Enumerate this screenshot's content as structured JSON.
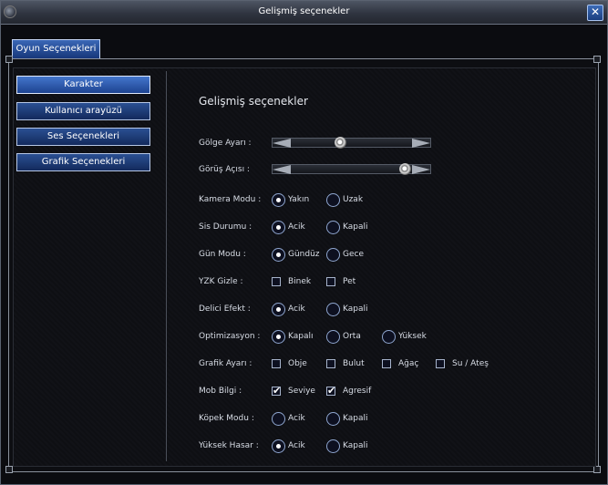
{
  "window": {
    "title": "Gelişmiş seçenekler",
    "close_glyph": "✕"
  },
  "tab": {
    "label": "Oyun Seçenekleri"
  },
  "menu": [
    {
      "label": "Karakter",
      "active": true
    },
    {
      "label": "Kullanıcı arayüzü",
      "active": false
    },
    {
      "label": "Ses Seçenekleri",
      "active": false
    },
    {
      "label": "Grafik Seçenekleri",
      "active": false
    }
  ],
  "content": {
    "title": "Gelişmiş seçenekler",
    "sliders": [
      {
        "label": "Gölge Ayarı :",
        "value": 0.43
      },
      {
        "label": "Görüş Açısı :",
        "value": 0.84
      }
    ],
    "rows": [
      {
        "label": "Kamera Modu :",
        "type": "radio",
        "options": [
          {
            "label": "Yakın",
            "selected": true
          },
          {
            "label": "Uzak",
            "selected": false
          }
        ]
      },
      {
        "label": "Sis Durumu :",
        "type": "radio",
        "options": [
          {
            "label": "Acik",
            "selected": true
          },
          {
            "label": "Kapali",
            "selected": false
          }
        ]
      },
      {
        "label": "Gün Modu :",
        "type": "radio",
        "options": [
          {
            "label": "Gündüz",
            "selected": true
          },
          {
            "label": "Gece",
            "selected": false
          }
        ]
      },
      {
        "label": "YZK Gizle :",
        "type": "check",
        "options": [
          {
            "label": "Binek",
            "selected": false
          },
          {
            "label": "Pet",
            "selected": false
          }
        ]
      },
      {
        "label": "Delici Efekt :",
        "type": "radio",
        "options": [
          {
            "label": "Acik",
            "selected": true
          },
          {
            "label": "Kapali",
            "selected": false
          }
        ]
      },
      {
        "label": "Optimizasyon :",
        "type": "radio",
        "options": [
          {
            "label": "Kapalı",
            "selected": true
          },
          {
            "label": "Orta",
            "selected": false
          },
          {
            "label": "Yüksek",
            "selected": false
          }
        ]
      },
      {
        "label": "Grafik Ayarı :",
        "type": "check",
        "options": [
          {
            "label": "Obje",
            "selected": false
          },
          {
            "label": "Bulut",
            "selected": false
          },
          {
            "label": "Ağaç",
            "selected": false
          },
          {
            "label": "Su / Ateş",
            "selected": false
          }
        ]
      },
      {
        "label": "Mob Bilgi :",
        "type": "check",
        "options": [
          {
            "label": "Seviye",
            "selected": true
          },
          {
            "label": "Agresif",
            "selected": true
          }
        ]
      },
      {
        "label": "Köpek Modu :",
        "type": "radio",
        "options": [
          {
            "label": "Acik",
            "selected": false
          },
          {
            "label": "Kapali",
            "selected": false
          }
        ]
      },
      {
        "label": "Yüksek Hasar :",
        "type": "radio",
        "options": [
          {
            "label": "Acik",
            "selected": true
          },
          {
            "label": "Kapali",
            "selected": false
          }
        ]
      }
    ]
  }
}
